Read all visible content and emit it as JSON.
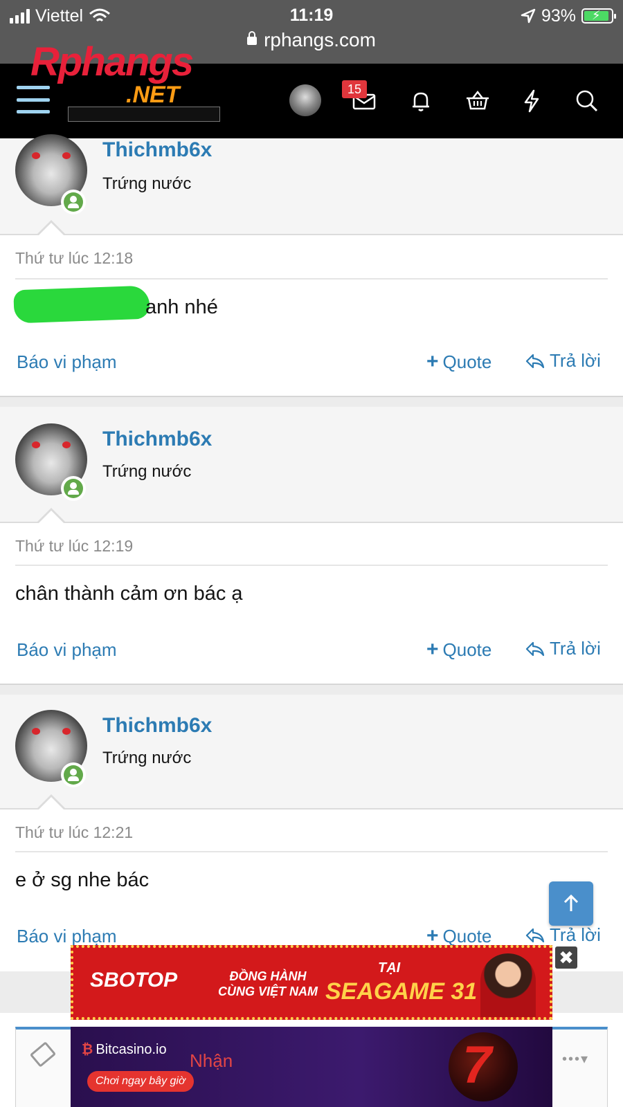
{
  "status_bar": {
    "carrier": "Viettel",
    "time": "11:19",
    "battery": "93%",
    "battery_level": 0.93,
    "url": "rphangs.com"
  },
  "nav": {
    "logo_main": "Rphangs",
    "logo_sub": ".NET",
    "inbox_badge": "15",
    "icons": [
      "menu-icon",
      "inbox-icon",
      "bell-icon",
      "basket-icon",
      "bolt-icon",
      "search-icon"
    ]
  },
  "posts": [
    {
      "username": "Thichmb6x",
      "user_title": "Trứng nước",
      "date": "Thứ tư lúc 12:18",
      "body": "anh nhé",
      "report": "Báo vi phạm",
      "quote": "Quote",
      "reply": "Trả lời"
    },
    {
      "username": "Thichmb6x",
      "user_title": "Trứng nước",
      "date": "Thứ tư lúc 12:19",
      "body": "chân thành cảm ơn bác ạ",
      "report": "Báo vi phạm",
      "quote": "Quote",
      "reply": "Trả lời"
    },
    {
      "username": "Thichmb6x",
      "user_title": "Trứng nước",
      "date": "Thứ tư lúc 12:21",
      "body": "e ở sg nhe bác",
      "report": "Báo vi phạm",
      "quote": "Quote",
      "reply": "Trả lời"
    }
  ],
  "ads": {
    "ad1": {
      "brand": "SBOTOP",
      "line1": "ĐỒNG HÀNH",
      "line2": "CÙNG VIỆT NAM",
      "tai": "TẠI",
      "event": "SEAGAME 31"
    },
    "ad2": {
      "brand": "Bitcasino.io",
      "text": "Nhận",
      "cta": "Chơi ngay bây giờ"
    },
    "close": "✖"
  },
  "colors": {
    "accent": "#2c7bb3",
    "online": "#62a94a",
    "badge": "#e0363c",
    "redaction": "#2ad83c"
  }
}
